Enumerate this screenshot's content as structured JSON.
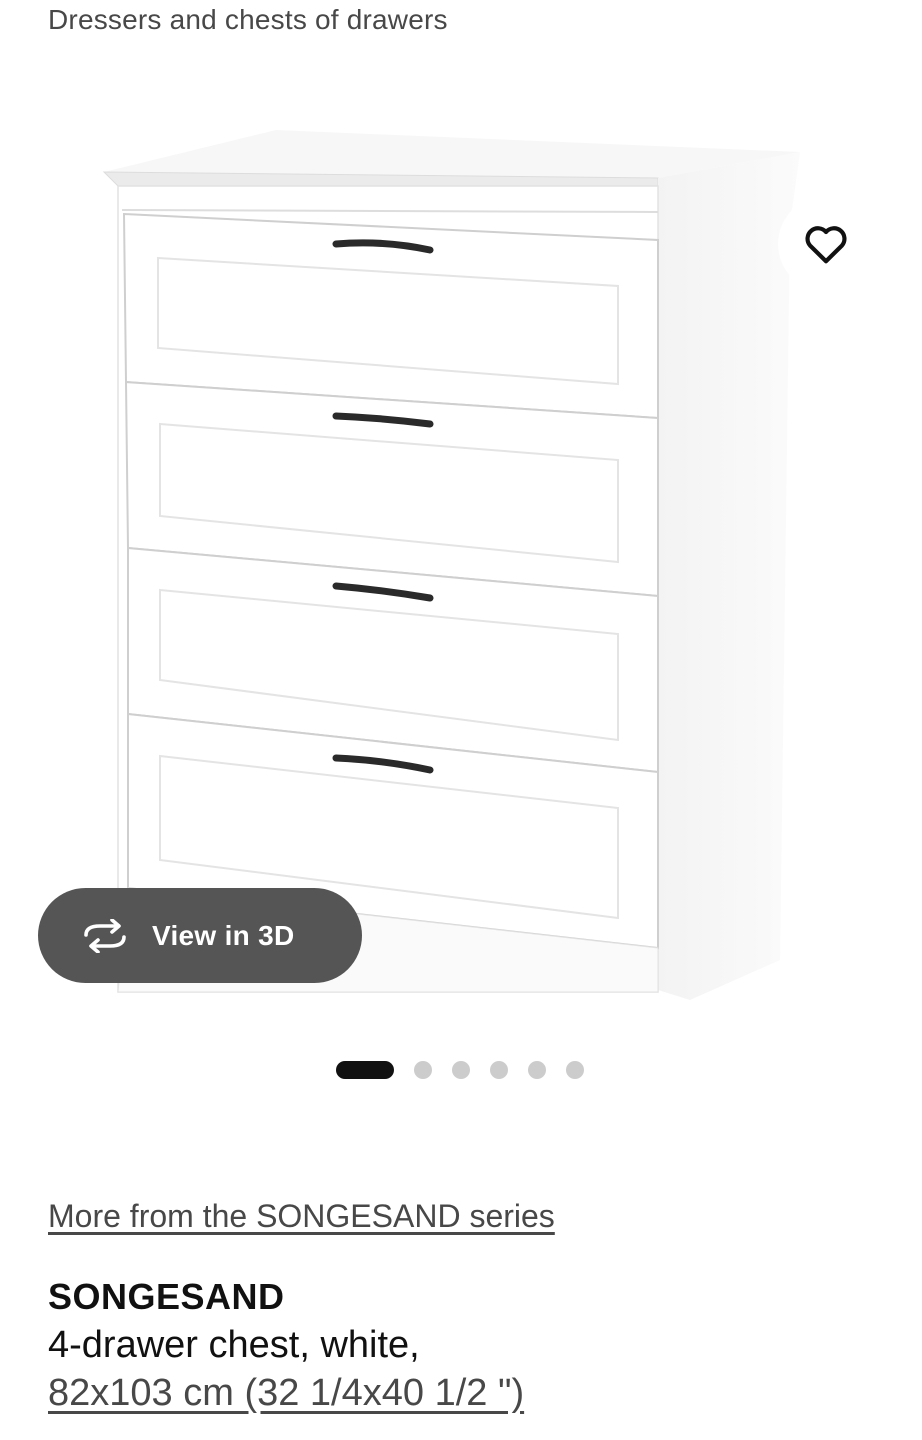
{
  "breadcrumb": {
    "label": "Dressers and chests of drawers"
  },
  "gallery": {
    "view_3d_label": "View in 3D",
    "favorite_icon": "heart-icon",
    "rotate_icon": "rotate-3d-icon",
    "image_count": 6,
    "active_image_index": 0
  },
  "product": {
    "series_link": "More from the SONGESAND series",
    "name": "SONGESAND",
    "description": "4-drawer chest, white,",
    "size": "82x103 cm (32 1/4x40 1/2 \")"
  },
  "colors": {
    "text_primary": "#111111",
    "text_secondary": "#484848",
    "button_dark": "#555555",
    "dot_active": "#111111",
    "dot_inactive": "#cccccc"
  }
}
